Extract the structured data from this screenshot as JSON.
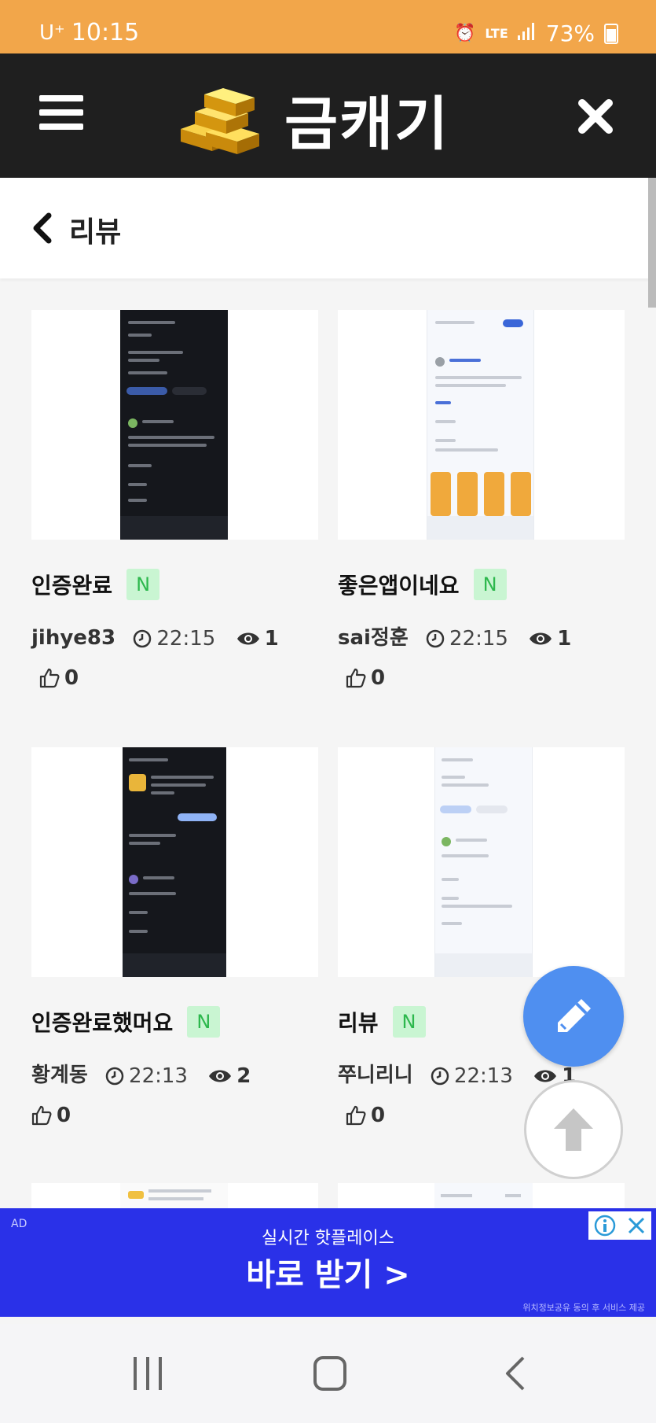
{
  "status_bar": {
    "carrier": "U⁺",
    "time": "10:15",
    "network": "LTE",
    "battery": "73%"
  },
  "header": {
    "app_name": "금캐기"
  },
  "subheader": {
    "title": "리뷰"
  },
  "posts": [
    {
      "title": "인증완료",
      "badge": "N",
      "author": "jihye83",
      "time": "22:15",
      "views": "1",
      "likes": "0"
    },
    {
      "title": "좋은앱이네요",
      "badge": "N",
      "author": "sai정훈",
      "time": "22:15",
      "views": "1",
      "likes": "0"
    },
    {
      "title": "인증완료했머요",
      "badge": "N",
      "author": "황계동",
      "time": "22:13",
      "views": "2",
      "likes": "0"
    },
    {
      "title": "리뷰",
      "badge": "N",
      "author": "쭈니리니",
      "time": "22:13",
      "views": "1",
      "likes": "0"
    }
  ],
  "ad": {
    "label": "AD",
    "line1": "실시간 핫플레이스",
    "line2": "바로 받기 >",
    "fine_print": "위치정보공유 동의 후 서비스 제공"
  },
  "colors": {
    "status_bar": "#f2a64a",
    "header_bg": "#1f1f1f",
    "fab_blue": "#4f8ff0",
    "badge_bg": "#c9f5d2",
    "badge_text": "#2db84d",
    "ad_bg": "#2a31e8"
  }
}
